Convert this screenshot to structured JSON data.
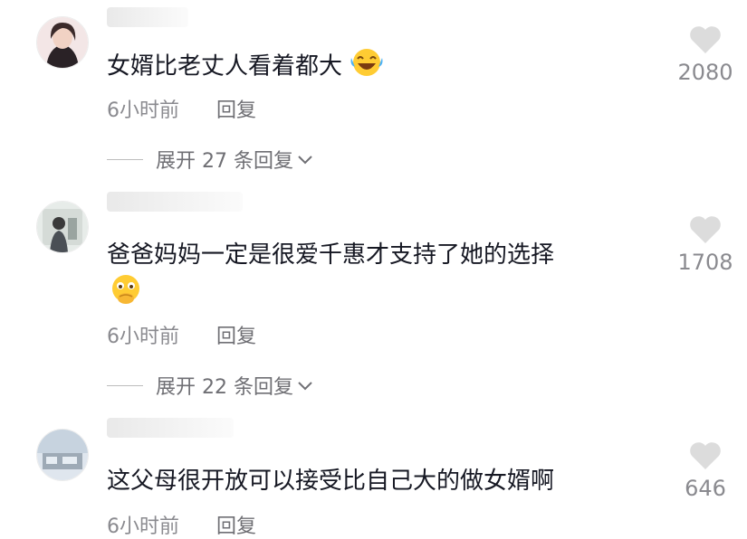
{
  "comments": [
    {
      "text": "女婿比老丈人看着都大",
      "emoji": "laughing-tears-emoji",
      "time": "6小时前",
      "reply_label": "回复",
      "likes": "2080",
      "expand_label": "展开 27 条回复"
    },
    {
      "text": "爸爸妈妈一定是很爱千惠才支持了她的选择",
      "emoji": "pleading-hands-emoji",
      "time": "6小时前",
      "reply_label": "回复",
      "likes": "1708",
      "expand_label": "展开 22 条回复"
    },
    {
      "text": "这父母很开放可以接受比自己大的做女婿啊",
      "time": "6小时前",
      "reply_label": "回复",
      "likes": "646"
    }
  ],
  "icons": {
    "like": "heart-icon",
    "expand": "chevron-down-icon"
  },
  "colors": {
    "text": "#161823",
    "meta": "#8a8a8f",
    "heart": "#dcdcdc"
  }
}
